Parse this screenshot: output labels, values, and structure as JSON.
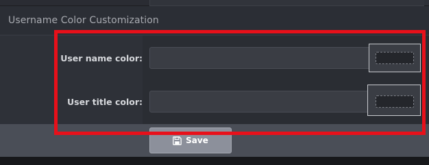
{
  "section": {
    "title": "Username Color Customization"
  },
  "fields": [
    {
      "label": "User name color:",
      "value": ""
    },
    {
      "label": "User title color:",
      "value": ""
    }
  ],
  "actions": {
    "save_label": "Save",
    "save_icon": "floppy-disk-icon"
  },
  "colors": {
    "highlight": "#e8101a",
    "page_bg": "#2a2d33",
    "button_bg": "#8c909b"
  }
}
